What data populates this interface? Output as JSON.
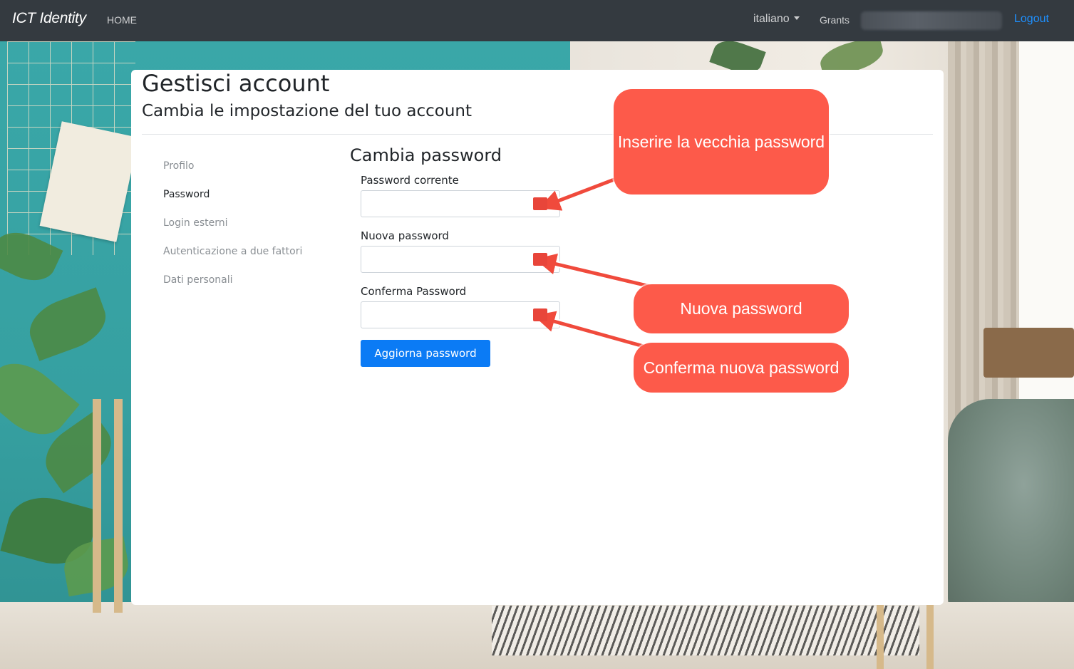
{
  "navbar": {
    "brand": "ICT Identity",
    "home": "HOME",
    "language": "italiano",
    "grants": "Grants",
    "logout": "Logout"
  },
  "page": {
    "title": "Gestisci account",
    "subtitle": "Cambia le impostazione del tuo account"
  },
  "sidebar": {
    "items": [
      {
        "label": "Profilo"
      },
      {
        "label": "Password"
      },
      {
        "label": "Login esterni"
      },
      {
        "label": "Autenticazione a due fattori"
      },
      {
        "label": "Dati personali"
      }
    ]
  },
  "form": {
    "title": "Cambia password",
    "current_label": "Password corrente",
    "current_value": "",
    "new_label": "Nuova password",
    "new_value": "",
    "confirm_label": "Conferma Password",
    "confirm_value": "",
    "submit": "Aggiorna password"
  },
  "annotations": {
    "old_password": "Inserire la vecchia password",
    "new_password": "Nuova password",
    "confirm_password": "Conferma nuova password"
  },
  "colors": {
    "navbar": "#343a40",
    "primary": "#0b7bf5",
    "logout_link": "#1e90ff",
    "callout": "#fd5a4a"
  }
}
